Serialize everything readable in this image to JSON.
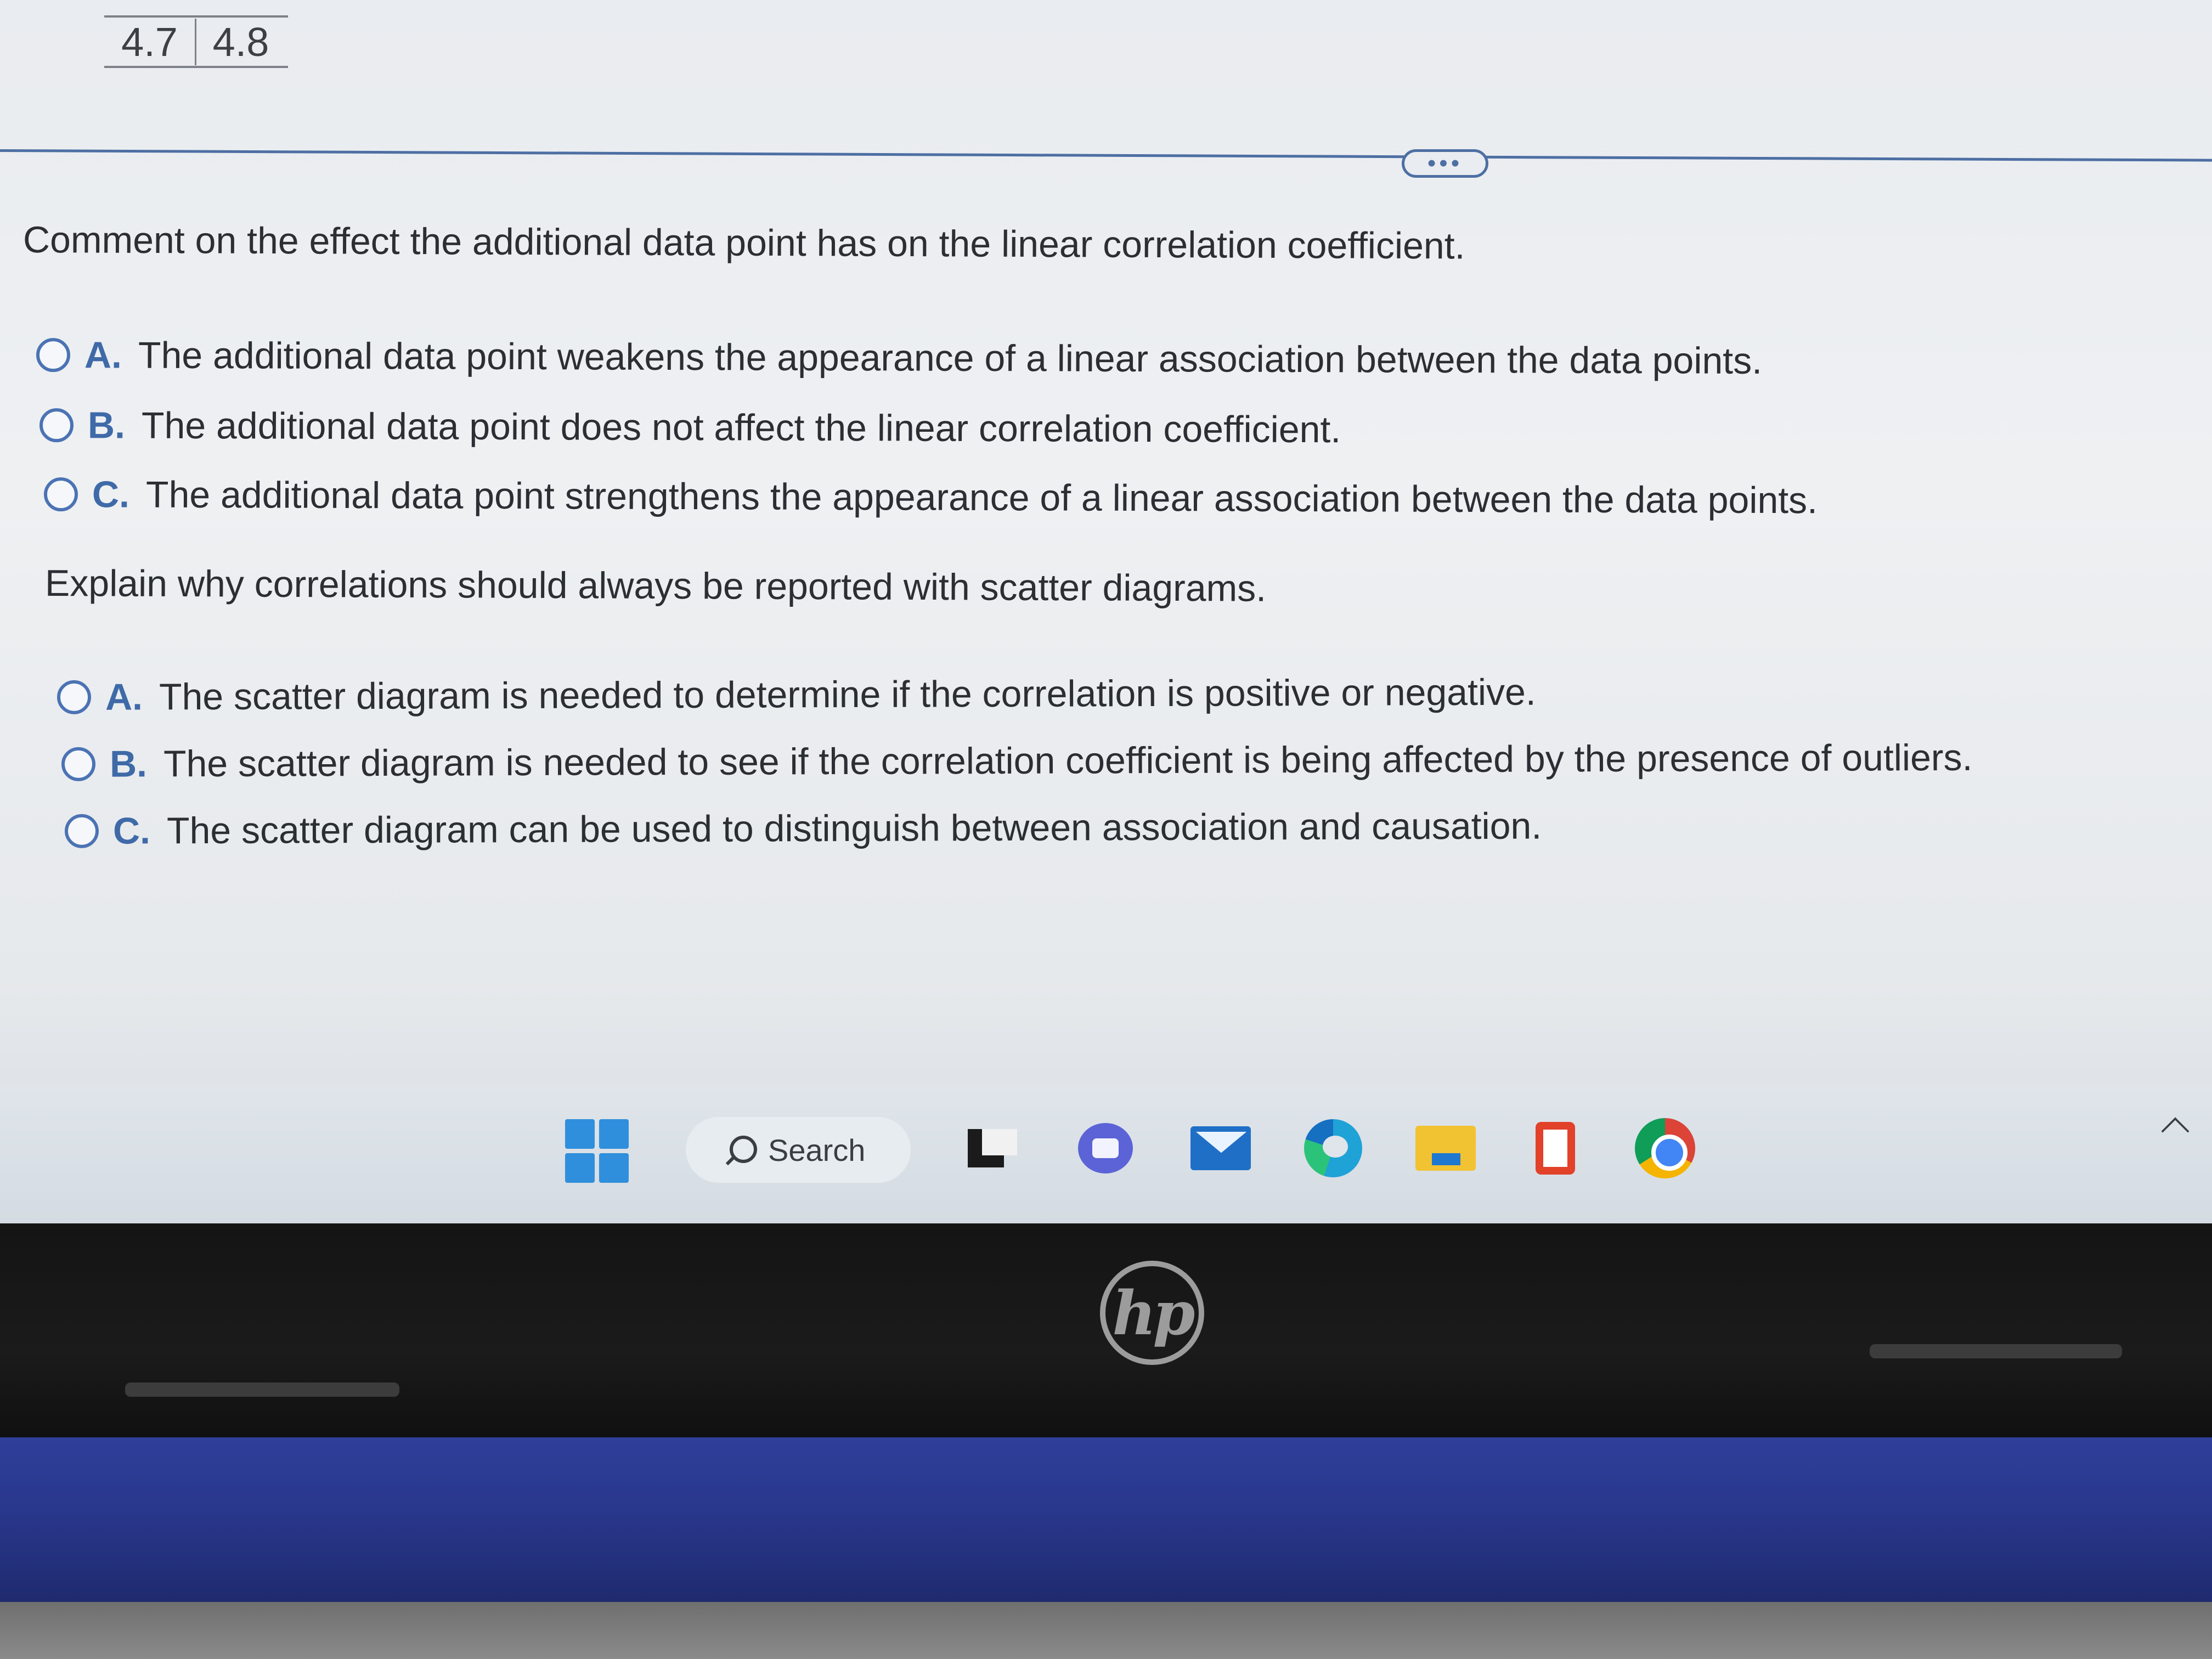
{
  "data_table": {
    "values": [
      "4.7",
      "4.8"
    ]
  },
  "divider": {
    "more_label": "•••"
  },
  "question_1": {
    "prompt": "Comment on the effect the additional data point has on the linear correlation coefficient.",
    "options": [
      {
        "letter": "A.",
        "text": "The additional data point weakens the appearance of a linear association between the data points."
      },
      {
        "letter": "B.",
        "text": "The additional data point does not affect the linear correlation coefficient."
      },
      {
        "letter": "C.",
        "text": "The additional data point strengthens the appearance of a linear association between the data points."
      }
    ]
  },
  "question_2": {
    "prompt": "Explain why correlations should always be reported with scatter diagrams.",
    "options": [
      {
        "letter": "A.",
        "text": "The scatter diagram is needed to determine if the correlation is positive or negative."
      },
      {
        "letter": "B.",
        "text": "The scatter diagram is needed to see if the correlation coefficient is being affected by the presence of outliers."
      },
      {
        "letter": "C.",
        "text": "The scatter diagram can be used to distinguish between association and causation."
      }
    ]
  },
  "taskbar": {
    "search_label": "Search",
    "icons": [
      "windows-start-icon",
      "search-icon",
      "task-view-icon",
      "chat-icon",
      "mail-icon",
      "edge-icon",
      "file-explorer-icon",
      "office-icon",
      "chrome-icon",
      "chevron-up-icon"
    ]
  },
  "device": {
    "logo_text": "hp"
  },
  "colors": {
    "accent": "#3f6aa8",
    "radio_border": "#4b73b4",
    "text": "#2b2e33",
    "chassis": "#28368a"
  }
}
